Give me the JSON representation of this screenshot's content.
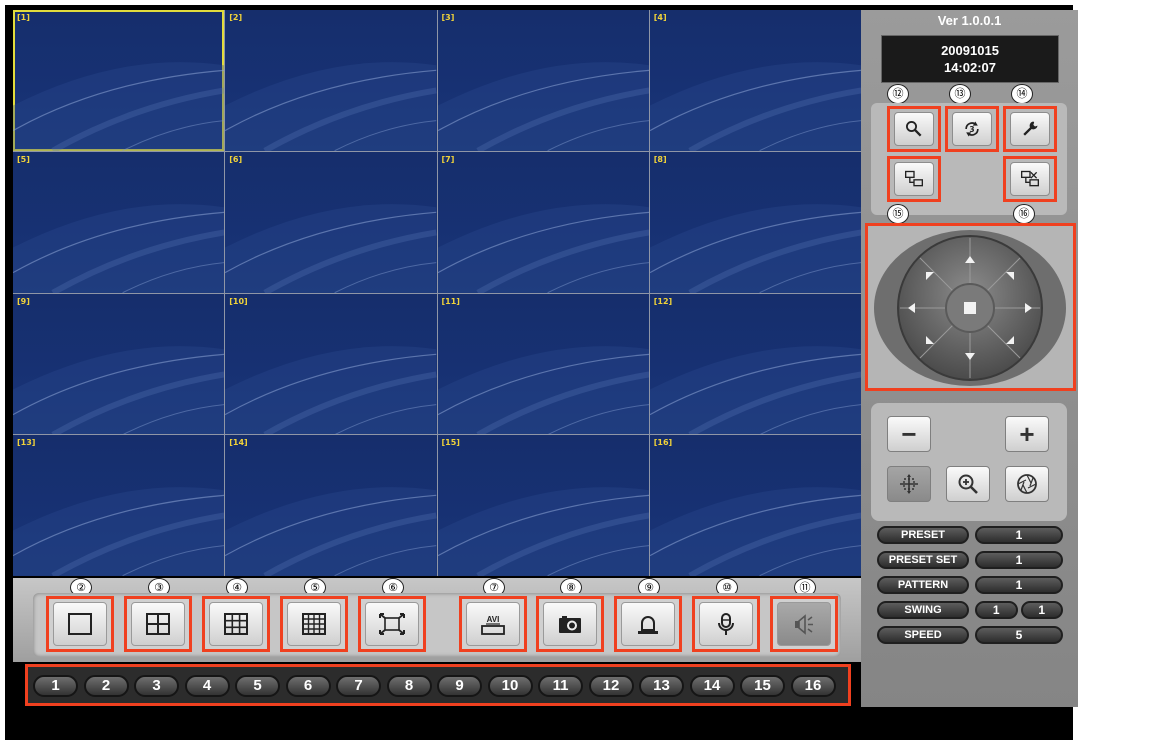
{
  "app": {
    "version": "Ver 1.0.0.1",
    "date": "20091015",
    "time": "14:02:07"
  },
  "cameras": [
    "[1]",
    "[2]",
    "[3]",
    "[4]",
    "[5]",
    "[6]",
    "[7]",
    "[8]",
    "[9]",
    "[10]",
    "[11]",
    "[12]",
    "[13]",
    "[14]",
    "[15]",
    "[16]"
  ],
  "selected_camera": "[1]",
  "toolbar": {
    "callouts": [
      "②",
      "③",
      "④",
      "⑤",
      "⑥",
      "⑦",
      "⑧",
      "⑨",
      "⑩",
      "⑪"
    ],
    "buttons": [
      {
        "name": "layout-1-button",
        "icon": "single-screen-icon"
      },
      {
        "name": "layout-4-button",
        "icon": "quad-screen-icon"
      },
      {
        "name": "layout-9-button",
        "icon": "nine-grid-icon"
      },
      {
        "name": "layout-16-button",
        "icon": "sixteen-grid-icon"
      },
      {
        "name": "fullscreen-button",
        "icon": "fullscreen-icon"
      },
      {
        "name": "avi-record-button",
        "icon": "avi-record-icon",
        "text": "AVI"
      },
      {
        "name": "snapshot-button",
        "icon": "camera-icon"
      },
      {
        "name": "alarm-button",
        "icon": "siren-icon"
      },
      {
        "name": "microphone-button",
        "icon": "microphone-icon"
      },
      {
        "name": "speaker-button",
        "icon": "speaker-icon"
      }
    ]
  },
  "channels": [
    "1",
    "2",
    "3",
    "4",
    "5",
    "6",
    "7",
    "8",
    "9",
    "10",
    "11",
    "12",
    "13",
    "14",
    "15",
    "16"
  ],
  "side_callouts": [
    "⑫",
    "⑬",
    "⑭",
    "⑮",
    "⑯"
  ],
  "side_tools": [
    {
      "name": "search-button",
      "icon": "search-icon"
    },
    {
      "name": "playback-button",
      "icon": "playback-icon"
    },
    {
      "name": "settings-button",
      "icon": "wrench-icon"
    },
    {
      "name": "connect-button",
      "icon": "connect-icon"
    },
    {
      "name": "disconnect-button",
      "icon": "disconnect-icon"
    }
  ],
  "ptz": {
    "minus": "−",
    "plus": "+",
    "icons": [
      "focus-icon",
      "zoom-in-icon",
      "iris-icon"
    ],
    "fields": [
      {
        "label": "PRESET",
        "values": [
          "1"
        ]
      },
      {
        "label": "PRESET SET",
        "values": [
          "1"
        ]
      },
      {
        "label": "PATTERN",
        "values": [
          "1"
        ]
      },
      {
        "label": "SWING",
        "values": [
          "1",
          "1"
        ]
      },
      {
        "label": "SPEED",
        "values": [
          "5"
        ]
      }
    ]
  },
  "colors": {
    "highlight": "#f0401f",
    "selection": "#e2dc3c",
    "video_bg": "#173173"
  }
}
